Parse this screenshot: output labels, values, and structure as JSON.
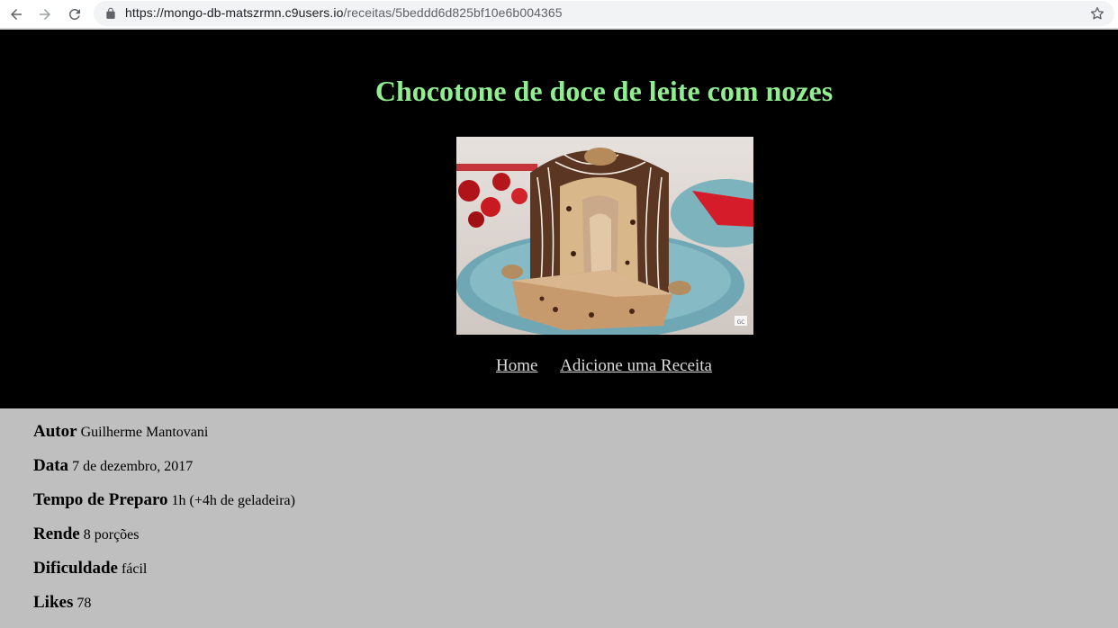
{
  "browser": {
    "url_domain": "https://mongo-db-matszrmn.c9users.io",
    "url_path": "/receitas/5beddd6d825bf10e6b004365",
    "icons": [
      "back-arrow-icon",
      "forward-arrow-icon",
      "reload-icon",
      "lock-icon",
      "star-icon"
    ]
  },
  "page": {
    "title": "Chocotone de doce de leite com nozes",
    "image_caption_badge": "GC",
    "nav": {
      "home": "Home",
      "add": "Adicione uma Receita"
    },
    "colors": {
      "header_bg": "#000000",
      "title": "#90ee90",
      "body_bg": "#bfbfbf"
    }
  },
  "recipe": {
    "fields": [
      {
        "label": "Autor",
        "value": "Guilherme Mantovani"
      },
      {
        "label": "Data",
        "value": "7 de dezembro, 2017"
      },
      {
        "label": "Tempo de Preparo",
        "value": "1h (+4h de geladeira)"
      },
      {
        "label": "Rende",
        "value": "8 porções"
      },
      {
        "label": "Dificuldade",
        "value": "fácil"
      },
      {
        "label": "Likes",
        "value": "78"
      }
    ]
  }
}
